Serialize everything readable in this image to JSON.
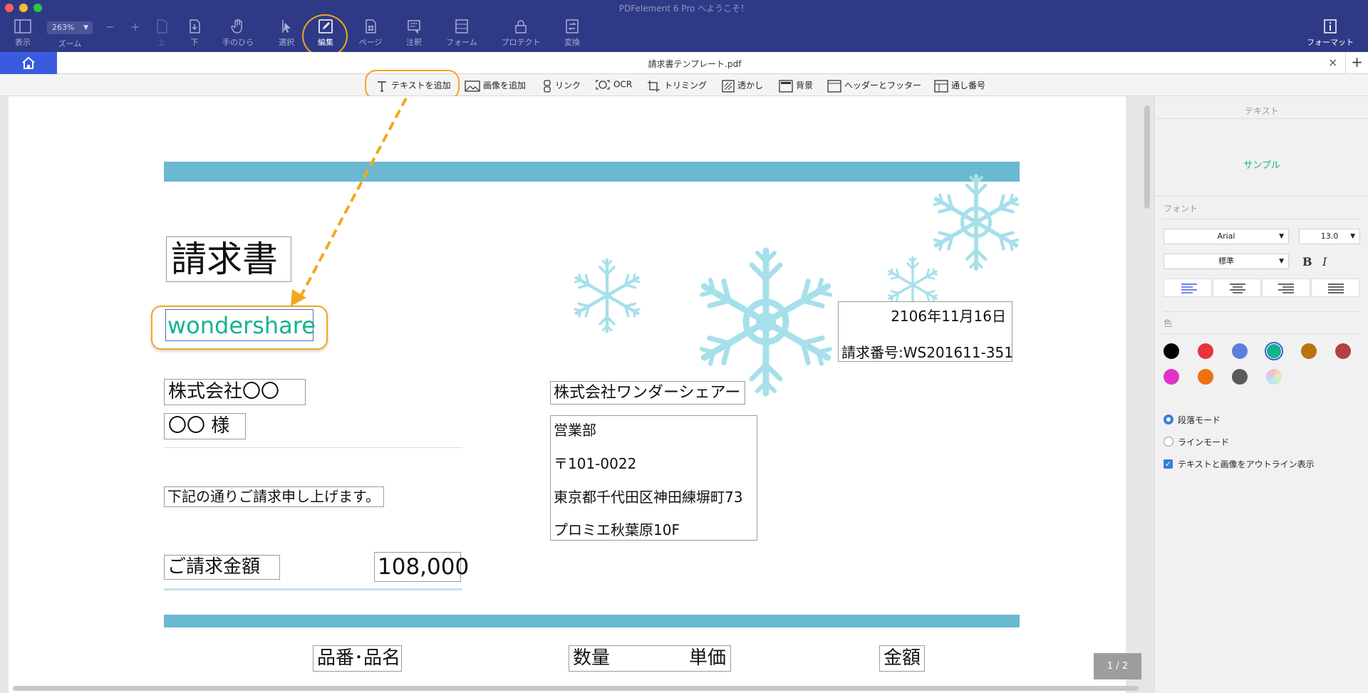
{
  "app": {
    "title": "PDFelement 6 Pro へようこそ！"
  },
  "toolbar": {
    "view_label": "表示",
    "zoom_label": "ズーム",
    "zoom_value": "263%",
    "zoom_minus": "−",
    "zoom_plus": "+",
    "up_label": "上",
    "down_label": "下",
    "hand_label": "手のひら",
    "select_label": "選択",
    "edit_label": "編集",
    "page_label": "ページ",
    "comment_label": "注釈",
    "form_label": "フォーム",
    "protect_label": "プロテクト",
    "convert_label": "変換",
    "format_label": "フォーマット"
  },
  "tab": {
    "title": "請求書テンプレート.pdf",
    "close": "×",
    "add": "+"
  },
  "edit_toolbar": {
    "add_text": "テキストを追加",
    "add_image": "画像を追加",
    "link": "リンク",
    "ocr": "OCR",
    "trim": "トリミング",
    "watermark": "透かし",
    "background": "背景",
    "header_footer": "ヘッダーとフッター",
    "bates": "通し番号"
  },
  "document": {
    "heading": "請求書",
    "wondershare": "wondershare",
    "date": "2106年11月16日",
    "invoice_no": "請求番号:WS201611-351",
    "client_company": "株式会社〇〇",
    "client_person": "〇〇 様",
    "vendor_company": "株式会社ワンダーシェアー",
    "dept": "営業部",
    "postal": "〒101-0022",
    "address": "東京都千代田区神田練塀町73",
    "building": "プロミエ秋葉原10F",
    "message": "下記の通りご請求申し上げます。",
    "amount_label": "ご請求金額",
    "amount_value": "108,000",
    "col_item": "品番･品名",
    "col_qty": "数量",
    "col_unit": "単価",
    "col_amount": "金額",
    "page_indicator": "1 / 2"
  },
  "sidebar": {
    "title": "テキスト",
    "sample": "サンプル",
    "font_section": "フォント",
    "font_name": "Arial",
    "font_size": "13.0",
    "font_style": "標準",
    "bold": "B",
    "italic": "I",
    "color_section": "色",
    "colors": [
      "#000000",
      "#e8333a",
      "#5a7fe0",
      "#13b48a",
      "#b8730f",
      "#b54040",
      "#e033c9",
      "#f06f10",
      "#5a5a5a"
    ],
    "mode_paragraph": "段落モード",
    "mode_line": "ラインモード",
    "outline_option": "テキストと画像をアウトライン表示"
  },
  "accent": {
    "highlight": "#f2a81d",
    "band": "#6ab9d1",
    "sample_text": "#13b48a"
  }
}
